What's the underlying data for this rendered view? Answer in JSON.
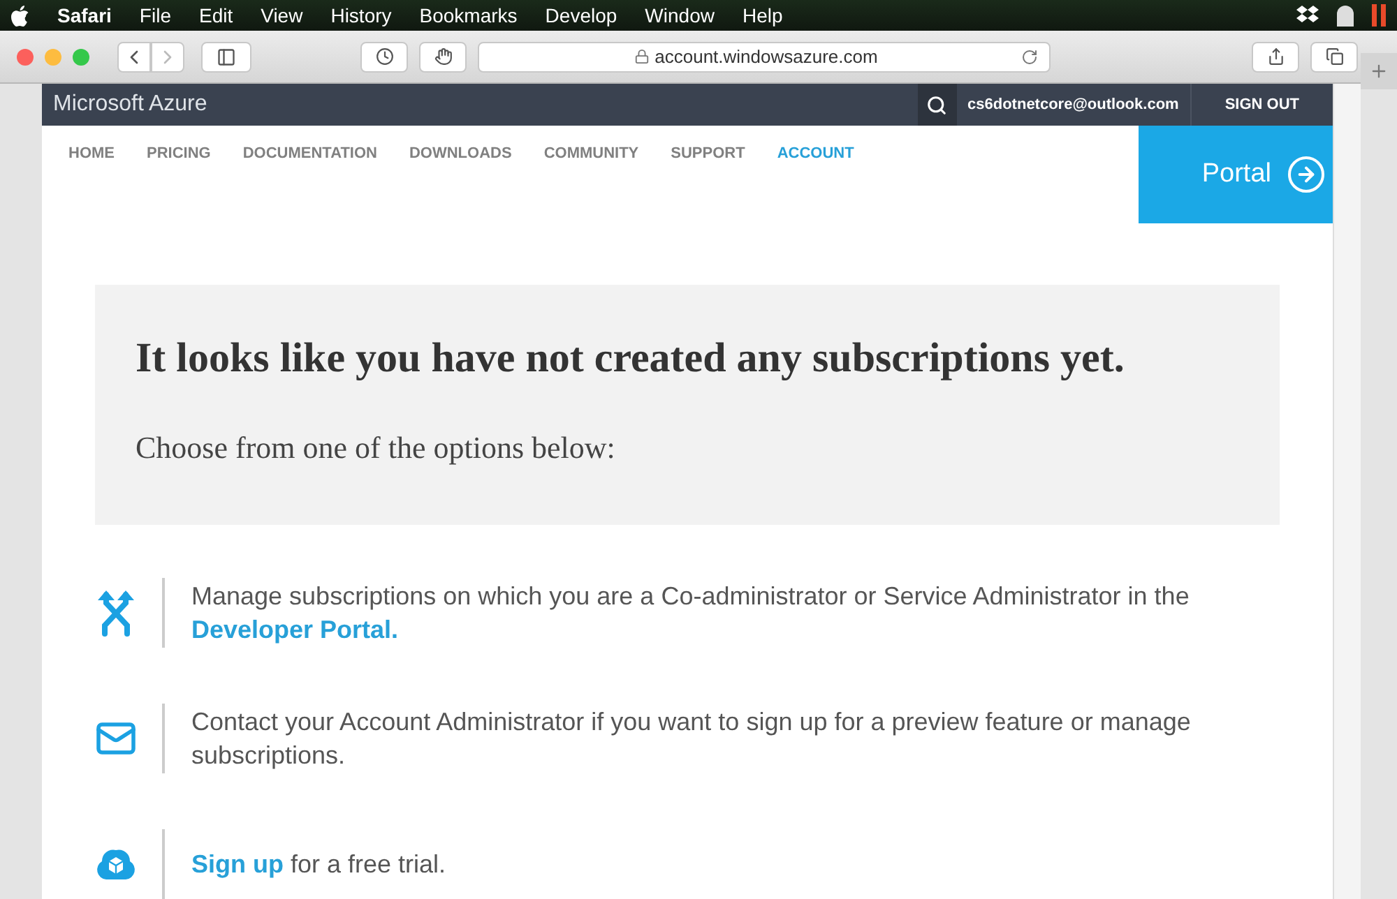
{
  "menu_bar": {
    "app": "Safari",
    "items": [
      "File",
      "Edit",
      "View",
      "History",
      "Bookmarks",
      "Develop",
      "Window",
      "Help"
    ]
  },
  "address_bar": {
    "url": "account.windowsazure.com"
  },
  "header": {
    "brand": "Microsoft Azure",
    "user": "cs6dotnetcore@outlook.com",
    "sign_out": "SIGN OUT"
  },
  "nav": [
    {
      "label": "HOME",
      "selected": false
    },
    {
      "label": "PRICING",
      "selected": false
    },
    {
      "label": "DOCUMENTATION",
      "selected": false
    },
    {
      "label": "DOWNLOADS",
      "selected": false
    },
    {
      "label": "COMMUNITY",
      "selected": false
    },
    {
      "label": "SUPPORT",
      "selected": false
    },
    {
      "label": "ACCOUNT",
      "selected": true
    }
  ],
  "portal_button": "Portal",
  "notice": {
    "title": "It looks like you have not created any subscriptions yet.",
    "subtitle": "Choose from one of the options below:"
  },
  "options": [
    {
      "kind": "arrows",
      "parts": [
        {
          "text": "Manage subscriptions on which you are a Co-administrator or Service Administrator in the ",
          "link": false
        },
        {
          "text": "Developer Portal.",
          "link": true
        }
      ]
    },
    {
      "kind": "mail",
      "parts": [
        {
          "text": "Contact your Account Administrator if you want to sign up for a preview feature or manage subscriptions.",
          "link": false
        }
      ]
    },
    {
      "kind": "cloud",
      "parts": [
        {
          "text": "Sign up",
          "link": true
        },
        {
          "text": " for a free trial.",
          "link": false
        }
      ]
    }
  ]
}
